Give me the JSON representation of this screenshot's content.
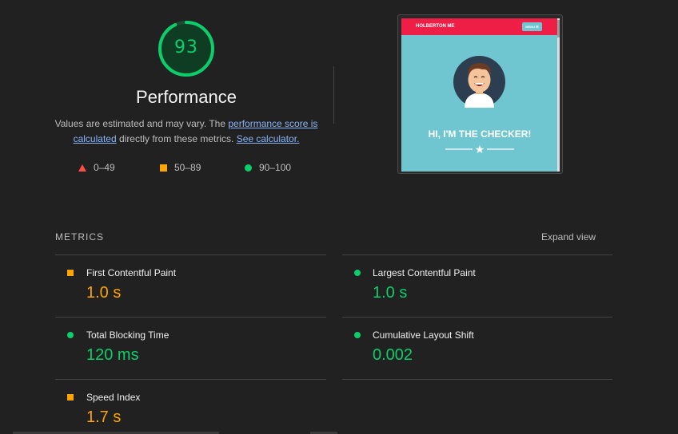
{
  "score": {
    "value": "93",
    "fraction": 0.93,
    "color": "#0cce6b"
  },
  "category_title": "Performance",
  "description": {
    "text_1": "Values are estimated and may vary. The ",
    "link_score": "performance score is calculated",
    "text_2": " directly from these metrics. ",
    "link_calculator": "See calculator."
  },
  "legend": [
    {
      "icon": "triangle-red",
      "label": "0–49"
    },
    {
      "icon": "square-orange",
      "label": "50–89"
    },
    {
      "icon": "circle-green",
      "label": "90–100"
    }
  ],
  "screenshot": {
    "brand": "HOLBERTON ME",
    "menu": "MENU ☰",
    "headline": "HI, I'M THE CHECKER!"
  },
  "metrics": {
    "section_label": "METRICS",
    "expand_label": "Expand view",
    "items": [
      {
        "name": "First Contentful Paint",
        "value": "1.0 s",
        "status": "average"
      },
      {
        "name": "Largest Contentful Paint",
        "value": "1.0 s",
        "status": "pass"
      },
      {
        "name": "Total Blocking Time",
        "value": "120 ms",
        "status": "pass"
      },
      {
        "name": "Cumulative Layout Shift",
        "value": "0.002",
        "status": "pass"
      },
      {
        "name": "Speed Index",
        "value": "1.7 s",
        "status": "average"
      }
    ]
  },
  "colors": {
    "pass": "#0cce6b",
    "average": "#ffa400",
    "fail": "#ff4e42",
    "link": "#8ab4f8"
  }
}
